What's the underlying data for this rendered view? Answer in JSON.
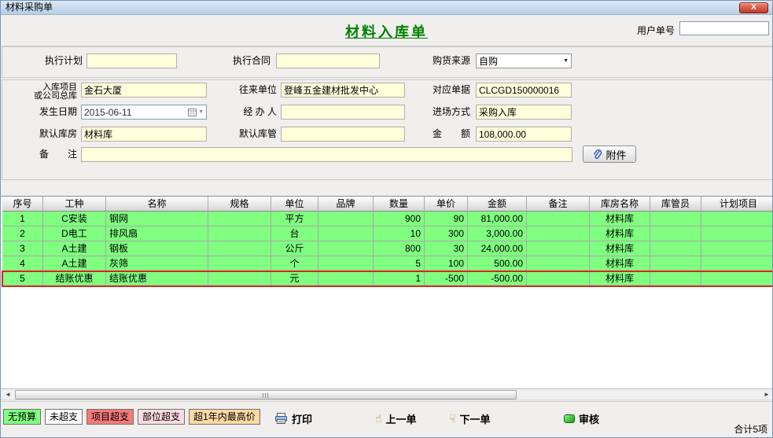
{
  "window": {
    "title": "材料采购单",
    "close_label": "X"
  },
  "header": {
    "doc_title": "材料入库单",
    "user_no_label": "用户单号",
    "user_no_value": ""
  },
  "form": {
    "exec_plan_label": "执行计划",
    "exec_plan_value": "",
    "exec_contract_label": "执行合同",
    "exec_contract_value": "",
    "source_label": "购货来源",
    "source_value": "自购",
    "project_label_line1": "入库项目",
    "project_label_line2": "或公司总库",
    "project_value": "金石大厦",
    "counterparty_label": "往来单位",
    "counterparty_value": "登峰五金建材批发中心",
    "ref_doc_label": "对应单据",
    "ref_doc_value": "CLCGD150000016",
    "date_label": "发生日期",
    "date_value": "2015-06-11",
    "handler_label": "经 办 人",
    "handler_value": "",
    "entry_mode_label": "进场方式",
    "entry_mode_value": "采购入库",
    "warehouse_label": "默认库房",
    "warehouse_value": "材料库",
    "keeper_label": "默认库管",
    "keeper_value": "",
    "amount_label": "金　　额",
    "amount_value": "108,000.00",
    "remark_label": "备　　注",
    "remark_value": "",
    "attachment_label": "附件"
  },
  "table": {
    "columns": [
      "序号",
      "工种",
      "名称",
      "规格",
      "单位",
      "品牌",
      "数量",
      "单价",
      "金额",
      "备注",
      "库房名称",
      "库管员",
      "计划项目"
    ],
    "rows": [
      [
        "1",
        "C安装",
        "钢网",
        "",
        "平方",
        "",
        "900",
        "90",
        "81,000.00",
        "",
        "材料库",
        "",
        ""
      ],
      [
        "2",
        "D电工",
        "排风扇",
        "",
        "台",
        "",
        "10",
        "300",
        "3,000.00",
        "",
        "材料库",
        "",
        ""
      ],
      [
        "3",
        "A土建",
        "钢板",
        "",
        "公斤",
        "",
        "800",
        "30",
        "24,000.00",
        "",
        "材料库",
        "",
        ""
      ],
      [
        "4",
        "A土建",
        "灰筛",
        "",
        "个",
        "",
        "5",
        "100",
        "500.00",
        "",
        "材料库",
        "",
        ""
      ],
      [
        "5",
        "结账优惠",
        "结账优惠",
        "",
        "元",
        "",
        "1",
        "-500",
        "-500.00",
        "",
        "材料库",
        "",
        ""
      ]
    ],
    "selected_row_index": 4
  },
  "footer": {
    "legend": [
      {
        "label": "无预算",
        "bg": "#80FF80"
      },
      {
        "label": "未超支",
        "bg": "#FFFFFF"
      },
      {
        "label": "项目超支",
        "bg": "#F47A7A"
      },
      {
        "label": "部位超支",
        "bg": "#FCDBE4"
      },
      {
        "label": "超1年内最高价",
        "bg": "#FCD9A4"
      }
    ],
    "print_label": "打印",
    "prev_label": "上一单",
    "next_label": "下一单",
    "audit_label": "审核",
    "total_label": "合计5项"
  },
  "colors": {
    "doc_title_green": "#008000",
    "row_green": "#80FF80",
    "selection_red": "#DD2222",
    "input_yellow": "#FFFFDC",
    "project_over_red": "#F47A7A"
  }
}
